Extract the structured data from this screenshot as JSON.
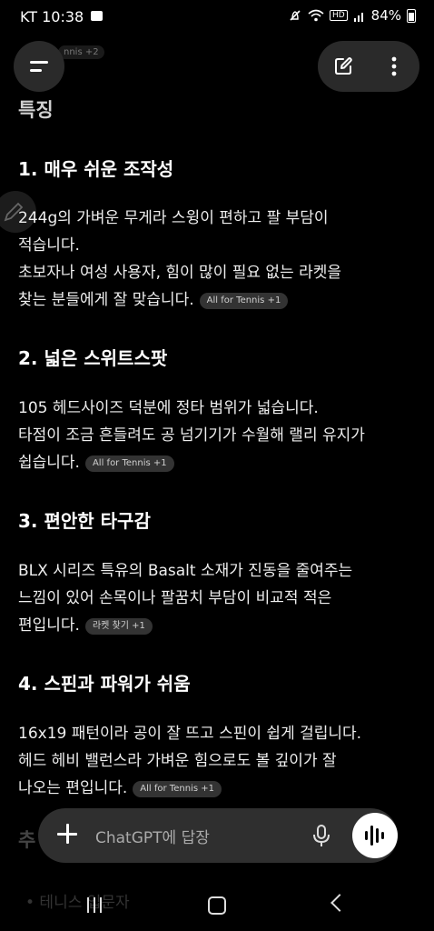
{
  "status_bar": {
    "carrier": "KT",
    "time": "10:38",
    "hd_label": "HD",
    "battery": "84%"
  },
  "ghost_chip": "nnis +2",
  "section_title": "특징",
  "features": [
    {
      "heading": "1. 매우 쉬운 조작성",
      "lines": [
        "244g의 가벼운 무게라 스윙이 편하고 팔 부담이",
        "적습니다.",
        "초보자나 여성 사용자, 힘이 많이 필요 없는 라켓을",
        "찾는 분들에게 잘 맞습니다."
      ],
      "chip": "All for Tennis +1"
    },
    {
      "heading": "2. 넓은 스위트스팟",
      "lines": [
        "105 헤드사이즈 덕분에 정타 범위가 넓습니다.",
        "타점이 조금 흔들려도 공 넘기기가 수월해 랠리 유지가",
        "쉽습니다."
      ],
      "chip": "All for Tennis +1"
    },
    {
      "heading": "3. 편안한 타구감",
      "lines": [
        "BLX 시리즈 특유의 Basalt 소재가 진동을 줄여주는",
        "느낌이 있어 손목이나 팔꿈치 부담이 비교적 적은",
        "편입니다."
      ],
      "chip": "라켓 찾기 +1"
    },
    {
      "heading": "4. 스핀과 파워가 쉬움",
      "lines": [
        "16x19 패턴이라 공이 잘 뜨고 스핀이 쉽게 걸립니다.",
        "헤드 헤비 밸런스라 가벼운 힘으로도 볼 깊이가 잘",
        "나오는 편입니다."
      ],
      "chip": "All for Tennis +1"
    }
  ],
  "bottom_ghost_title": "추",
  "bottom_ghost_item": "• 테니스 입문자",
  "input": {
    "placeholder": "ChatGPT에 답장"
  },
  "icons": {
    "menu": "menu-icon",
    "edit": "new-chat-icon",
    "more": "more-vertical-icon",
    "plus": "plus-icon",
    "mic": "microphone-icon",
    "voice": "voice-mode-icon"
  }
}
